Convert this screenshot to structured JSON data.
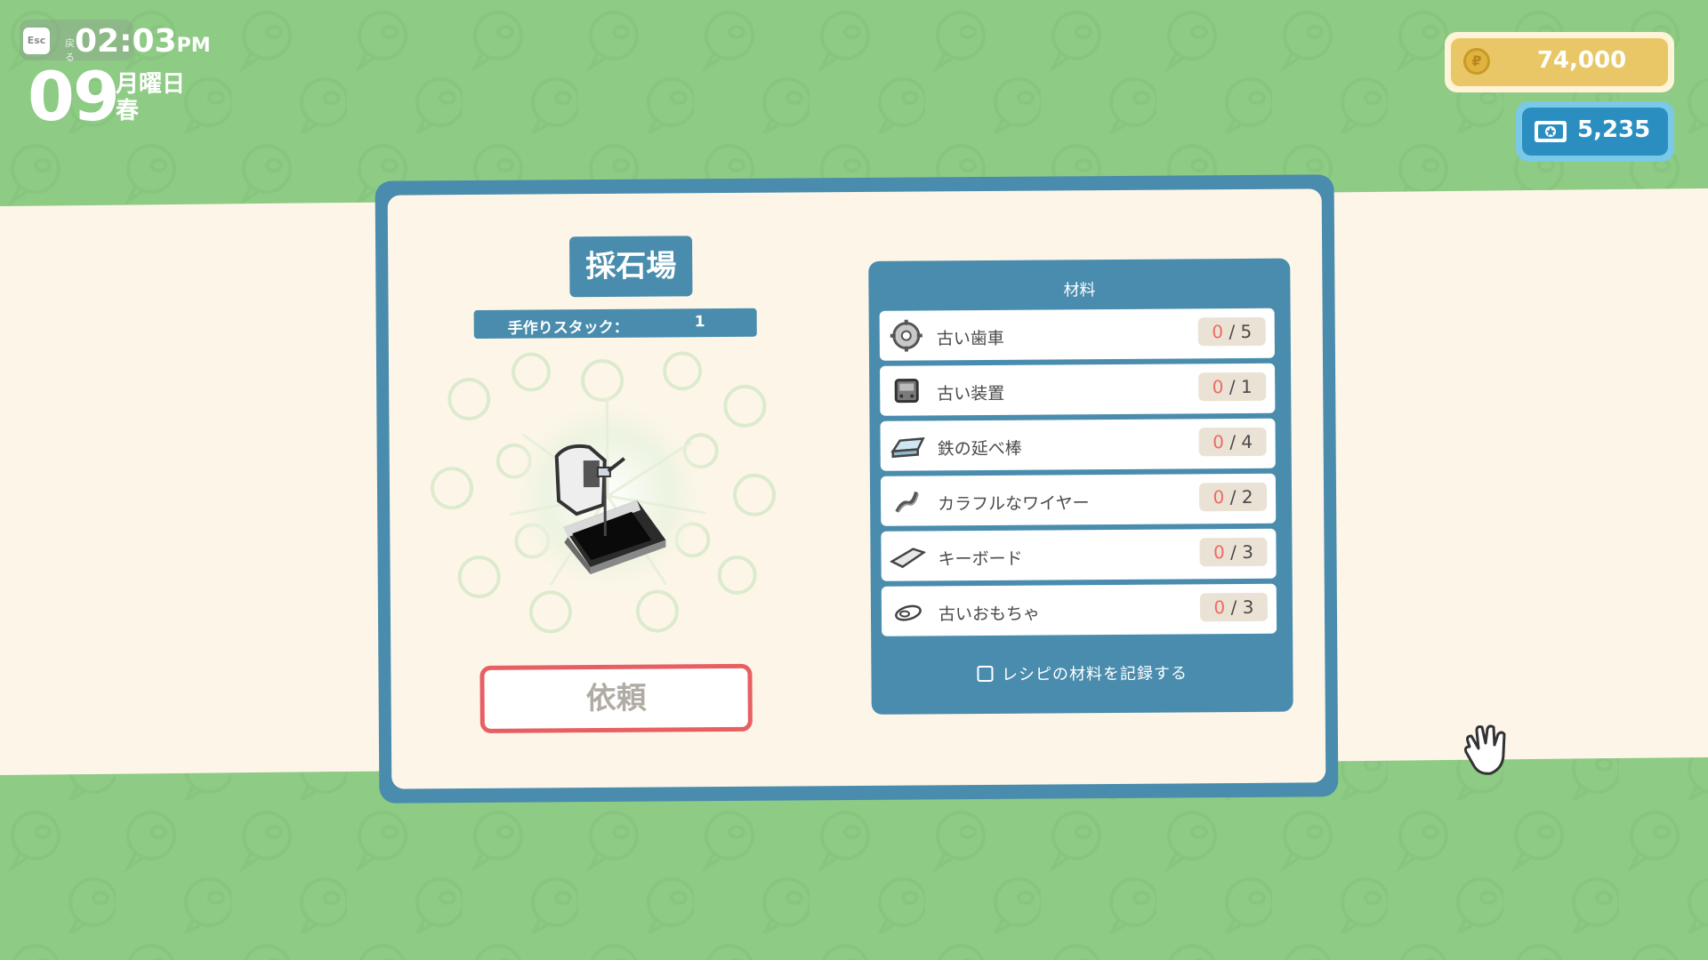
{
  "hud": {
    "esc_key": "Esc",
    "back_label": "戻る",
    "time": "02:03",
    "ampm": "PM",
    "day": "09",
    "weekday": "月曜日",
    "season": "春"
  },
  "currency": {
    "coins": "74,000",
    "tickets": "5,235"
  },
  "facility": {
    "title": "採石場",
    "stack_label": "手作りスタック：",
    "stack_value": "1",
    "item_icon": "quarry-machine-icon",
    "request_label": "依頼"
  },
  "materials": {
    "header": "材料",
    "items": [
      {
        "icon": "old-gear-icon",
        "name": "古い歯車",
        "have": "0",
        "need": "/ 5"
      },
      {
        "icon": "old-device-icon",
        "name": "古い装置",
        "have": "0",
        "need": "/ 1"
      },
      {
        "icon": "iron-ingot-icon",
        "name": "鉄の延べ棒",
        "have": "0",
        "need": "/ 4"
      },
      {
        "icon": "colorful-wire-icon",
        "name": "カラフルなワイヤー",
        "have": "0",
        "need": "/ 2"
      },
      {
        "icon": "keyboard-icon",
        "name": "キーボード",
        "have": "0",
        "need": "/ 3"
      },
      {
        "icon": "old-toy-icon",
        "name": "古いおもちゃ",
        "have": "0",
        "need": "/ 3"
      }
    ],
    "record_label": "レシピの材料を記録する"
  },
  "colors": {
    "background_green": "#8ecb85",
    "panel_blue": "#4a8cad",
    "cream": "#fdf6e8",
    "request_red": "#e85f63",
    "coin_gold": "#e9c766",
    "ticket_blue": "#2a8fc0"
  }
}
